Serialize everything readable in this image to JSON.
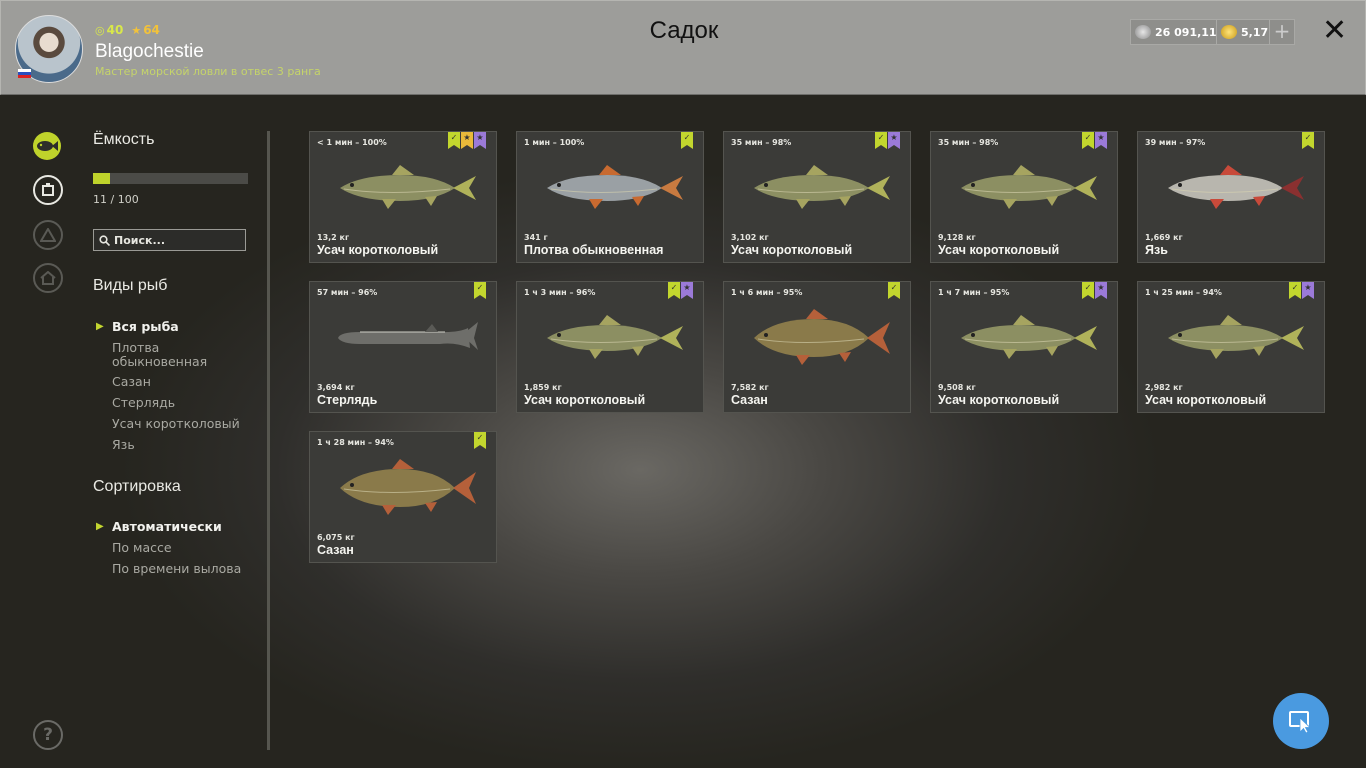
{
  "header": {
    "title": "Садок",
    "username": "Blagochestie",
    "level": "40",
    "rank": "64",
    "subtitle": "Мастер морской ловли в отвес 3 ранга",
    "silver": "26 091,11",
    "gold": "5,17",
    "plus_label": "+",
    "close_label": "✕",
    "avatar_icon": "avatar-photo",
    "flag_icon": "russia-flag-icon"
  },
  "sidebar": {
    "capacity_title": "Ёмкость",
    "capacity_text": "11 / 100",
    "capacity_fraction": 0.11,
    "search_placeholder": "Поиск...",
    "species_title": "Виды рыб",
    "species": [
      "Вся рыба",
      "Плотва обыкновенная",
      "Сазан",
      "Стерлядь",
      "Усач коротколовый",
      "Язь"
    ],
    "sort_title": "Сортировка",
    "sort_options": [
      "Автоматически",
      "По массе",
      "По времени вылова"
    ],
    "help_label": "?"
  },
  "colors": {
    "accent": "#bfd32b",
    "badge_green": "#c2d62e",
    "badge_yellow": "#e9b93a",
    "badge_purple": "#9b7ad8",
    "cursor_button": "#4a9ae0"
  },
  "fish": [
    {
      "time": "< 1 мин – 100%",
      "weight": "13,2 кг",
      "name": "Усач коротколовый",
      "badges": [
        "check-green",
        "star-yellow",
        "star-purple"
      ]
    },
    {
      "time": "1 мин – 100%",
      "weight": "341 г",
      "name": "Плотва обыкновенная",
      "badges": [
        "check-green"
      ]
    },
    {
      "time": "35 мин – 98%",
      "weight": "3,102 кг",
      "name": "Усач коротколовый",
      "badges": [
        "check-green",
        "star-purple"
      ]
    },
    {
      "time": "35 мин – 98%",
      "weight": "9,128 кг",
      "name": "Усач коротколовый",
      "badges": [
        "check-green",
        "star-purple"
      ]
    },
    {
      "time": "39 мин – 97%",
      "weight": "1,669 кг",
      "name": "Язь",
      "badges": [
        "check-green"
      ]
    },
    {
      "time": "57 мин – 96%",
      "weight": "3,694 кг",
      "name": "Стерлядь",
      "badges": [
        "check-green"
      ]
    },
    {
      "time": "1 ч 3 мин – 96%",
      "weight": "1,859 кг",
      "name": "Усач коротколовый",
      "badges": [
        "check-green",
        "star-purple"
      ]
    },
    {
      "time": "1 ч 6 мин – 95%",
      "weight": "7,582 кг",
      "name": "Сазан",
      "badges": [
        "check-green"
      ]
    },
    {
      "time": "1 ч 7 мин – 95%",
      "weight": "9,508 кг",
      "name": "Усач коротколовый",
      "badges": [
        "check-green",
        "star-purple"
      ]
    },
    {
      "time": "1 ч 25 мин – 94%",
      "weight": "2,982 кг",
      "name": "Усач коротколовый",
      "badges": [
        "check-green",
        "star-purple"
      ]
    },
    {
      "time": "1 ч 28 мин – 94%",
      "weight": "6,075 кг",
      "name": "Сазан",
      "badges": [
        "check-green"
      ]
    }
  ]
}
